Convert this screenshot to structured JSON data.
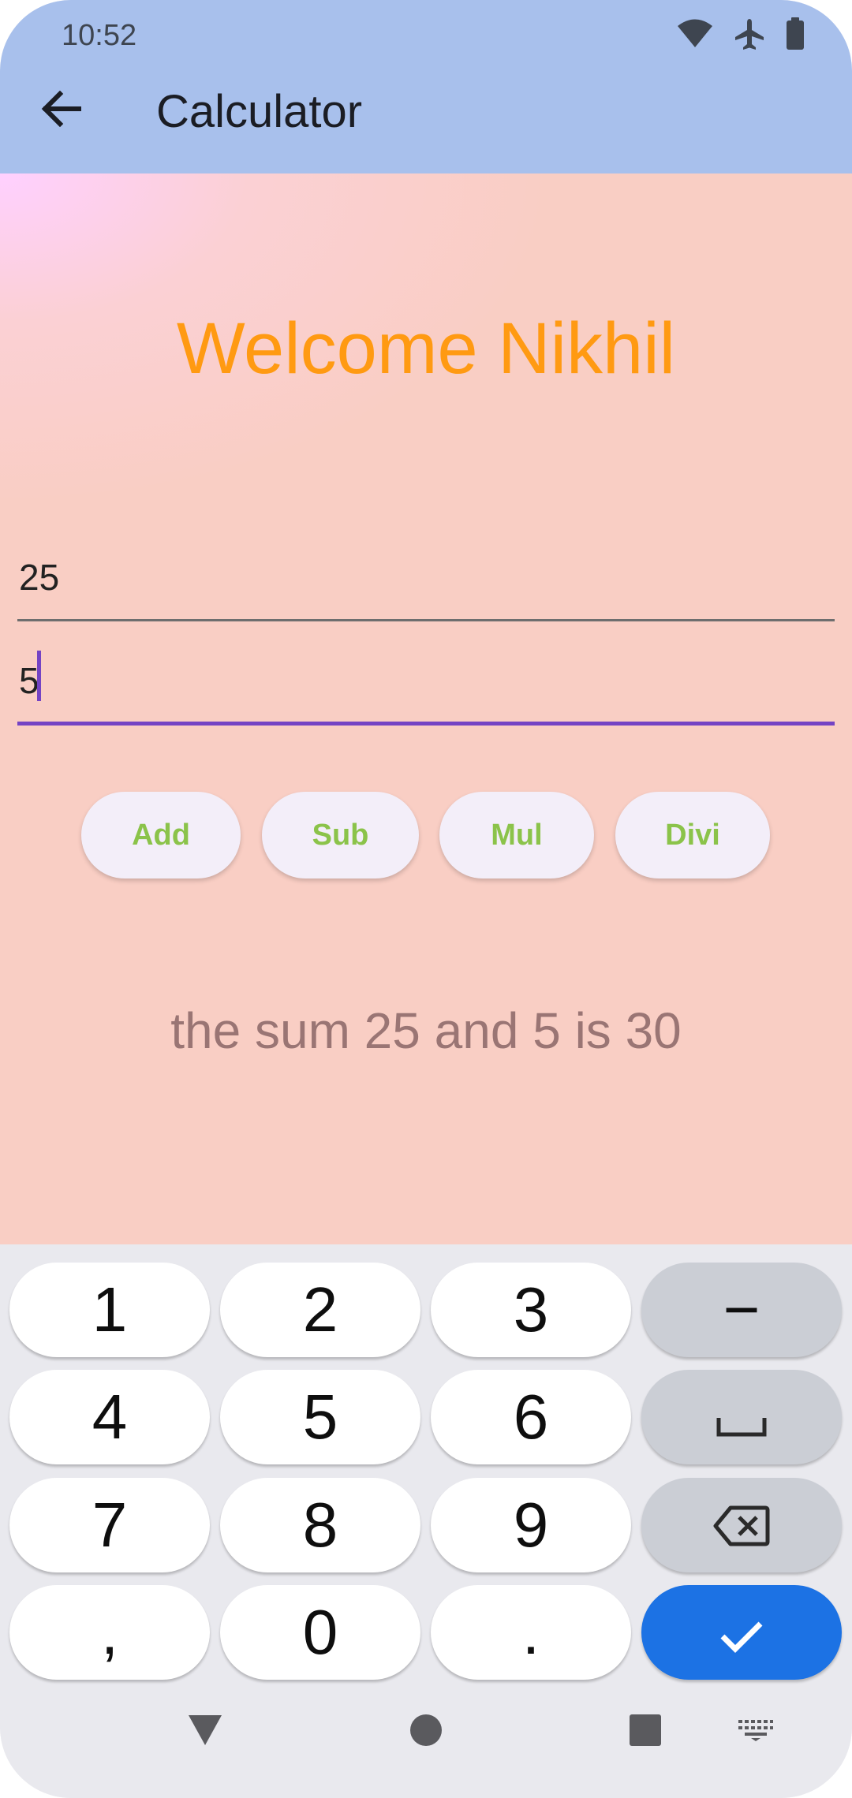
{
  "status_bar": {
    "time": "10:52",
    "icons": [
      "wifi-icon",
      "airplane-icon",
      "battery-icon"
    ]
  },
  "app_bar": {
    "back_icon": "arrow-left-icon",
    "title": "Calculator"
  },
  "content": {
    "welcome": "Welcome Nikhil",
    "input1": {
      "value": "25"
    },
    "input2": {
      "value": "5"
    },
    "buttons": {
      "add": "Add",
      "sub": "Sub",
      "mul": "Mul",
      "divi": "Divi"
    },
    "result": "the sum 25 and 5 is 30"
  },
  "keyboard": {
    "rows": [
      [
        "1",
        "2",
        "3",
        "-"
      ],
      [
        "4",
        "5",
        "6",
        "space-icon"
      ],
      [
        "7",
        "8",
        "9",
        "backspace-icon"
      ],
      [
        ",",
        "0",
        ".",
        "check-icon"
      ]
    ],
    "labels": {
      "k1": "1",
      "k2": "2",
      "k3": "3",
      "minus": "−",
      "k4": "4",
      "k5": "5",
      "k6": "6",
      "k7": "7",
      "k8": "8",
      "k9": "9",
      "comma": ",",
      "k0": "0",
      "period": "."
    }
  },
  "nav_bar": {
    "icons": [
      "back-triangle-icon",
      "home-circle-icon",
      "recents-square-icon",
      "keyboard-icon"
    ]
  },
  "colors": {
    "app_bar": "#a8c0ec",
    "content_bg": "#f9cec4",
    "welcome": "#ff9a12",
    "button_text": "#8bc34a",
    "accent": "#7443c4",
    "result": "#9a7574",
    "done_key": "#1c72e4"
  }
}
